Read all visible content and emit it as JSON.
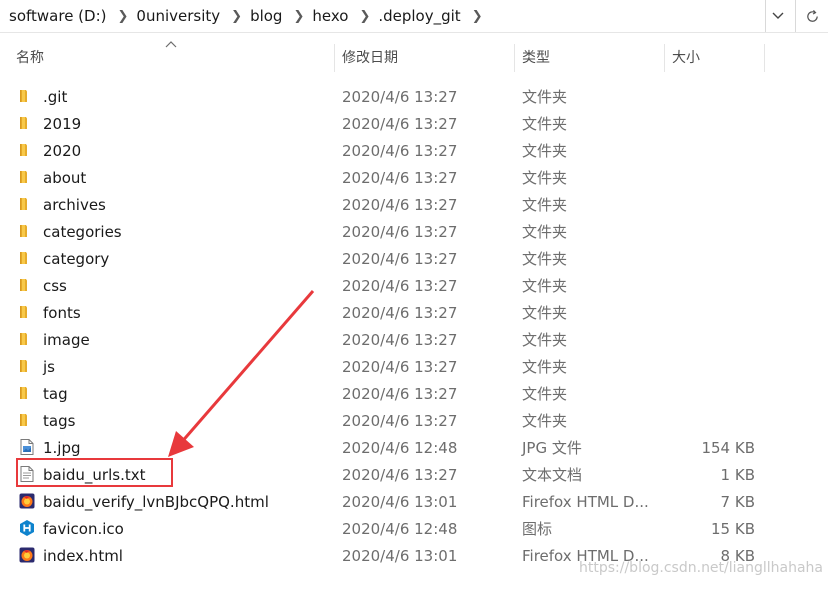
{
  "breadcrumb": [
    "software (D:)",
    "0university",
    "blog",
    "hexo",
    ".deploy_git"
  ],
  "columns": {
    "name": "名称",
    "date": "修改日期",
    "type": "类型",
    "size": "大小"
  },
  "files": [
    {
      "name": ".git",
      "date": "2020/4/6 13:27",
      "type": "文件夹",
      "size": "",
      "icon": "folder"
    },
    {
      "name": "2019",
      "date": "2020/4/6 13:27",
      "type": "文件夹",
      "size": "",
      "icon": "folder"
    },
    {
      "name": "2020",
      "date": "2020/4/6 13:27",
      "type": "文件夹",
      "size": "",
      "icon": "folder"
    },
    {
      "name": "about",
      "date": "2020/4/6 13:27",
      "type": "文件夹",
      "size": "",
      "icon": "folder"
    },
    {
      "name": "archives",
      "date": "2020/4/6 13:27",
      "type": "文件夹",
      "size": "",
      "icon": "folder"
    },
    {
      "name": "categories",
      "date": "2020/4/6 13:27",
      "type": "文件夹",
      "size": "",
      "icon": "folder"
    },
    {
      "name": "category",
      "date": "2020/4/6 13:27",
      "type": "文件夹",
      "size": "",
      "icon": "folder"
    },
    {
      "name": "css",
      "date": "2020/4/6 13:27",
      "type": "文件夹",
      "size": "",
      "icon": "folder"
    },
    {
      "name": "fonts",
      "date": "2020/4/6 13:27",
      "type": "文件夹",
      "size": "",
      "icon": "folder"
    },
    {
      "name": "image",
      "date": "2020/4/6 13:27",
      "type": "文件夹",
      "size": "",
      "icon": "folder"
    },
    {
      "name": "js",
      "date": "2020/4/6 13:27",
      "type": "文件夹",
      "size": "",
      "icon": "folder"
    },
    {
      "name": "tag",
      "date": "2020/4/6 13:27",
      "type": "文件夹",
      "size": "",
      "icon": "folder"
    },
    {
      "name": "tags",
      "date": "2020/4/6 13:27",
      "type": "文件夹",
      "size": "",
      "icon": "folder"
    },
    {
      "name": "1.jpg",
      "date": "2020/4/6 12:48",
      "type": "JPG 文件",
      "size": "154 KB",
      "icon": "image"
    },
    {
      "name": "baidu_urls.txt",
      "date": "2020/4/6 13:27",
      "type": "文本文档",
      "size": "1 KB",
      "icon": "text"
    },
    {
      "name": "baidu_verify_lvnBJbcQPQ.html",
      "date": "2020/4/6 13:01",
      "type": "Firefox HTML D...",
      "size": "7 KB",
      "icon": "firefox"
    },
    {
      "name": "favicon.ico",
      "date": "2020/4/6 12:48",
      "type": "图标",
      "size": "15 KB",
      "icon": "hexo"
    },
    {
      "name": "index.html",
      "date": "2020/4/6 13:01",
      "type": "Firefox HTML D...",
      "size": "8 KB",
      "icon": "firefox"
    }
  ],
  "watermark": "https://blog.csdn.net/liangllhahaha",
  "colors": {
    "annotation": "#e8393c",
    "folder": "#f8c94a",
    "hexo": "#0e83cd"
  }
}
